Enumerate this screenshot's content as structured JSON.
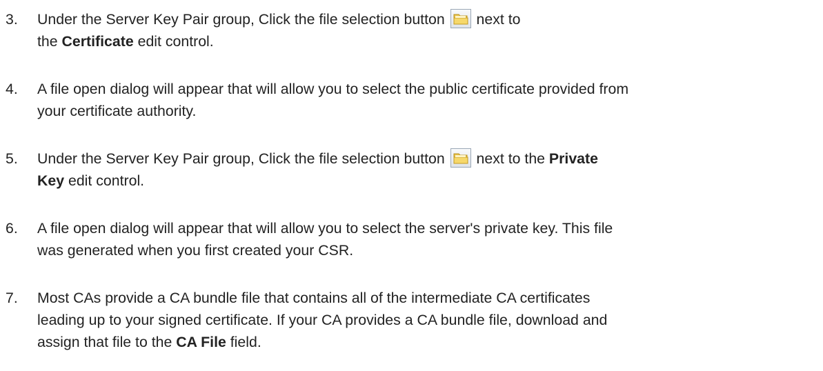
{
  "steps": [
    {
      "number": "3.",
      "lines": [
        {
          "before": "Under the Server Key Pair group, Click the file selection button",
          "icon": "folder-open-icon",
          "after": "next to"
        },
        {
          "prefix": "the ",
          "bold": "Certificate",
          "suffix": " edit control."
        }
      ]
    },
    {
      "number": "4.",
      "lines": [
        {
          "text": "A file open dialog will appear that will allow you to select the public certificate provided from"
        },
        {
          "text": "your certificate authority."
        }
      ]
    },
    {
      "number": "5.",
      "lines": [
        {
          "before": "Under the Server Key Pair group, Click the file selection button",
          "icon": "folder-open-icon",
          "after": "next to the ",
          "bold": "Private"
        },
        {
          "bold": "Key",
          "suffix": " edit control."
        }
      ]
    },
    {
      "number": "6.",
      "lines": [
        {
          "text": "A file open dialog will appear that will allow you to select the server's private key. This file"
        },
        {
          "text": "was generated when you first created your CSR."
        }
      ]
    },
    {
      "number": "7.",
      "lines": [
        {
          "text": "Most CAs provide a CA bundle file that contains all of the intermediate CA certificates"
        },
        {
          "text": "leading up to your signed certificate. If your CA provides a CA bundle file, download and"
        },
        {
          "prefix": "assign that file to the ",
          "bold": "CA File",
          "suffix": " field."
        }
      ]
    }
  ]
}
